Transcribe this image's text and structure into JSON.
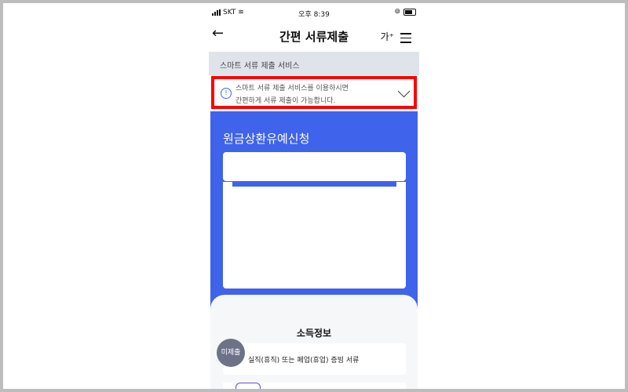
{
  "status_bar": {
    "carrier": "SKT",
    "time": "오후 8:39"
  },
  "header": {
    "title": "간편 서류제출",
    "font_size_label": "가⁺"
  },
  "section": {
    "label": "스마트 서류 제출 서비스"
  },
  "notice": {
    "line1": "스마트 서류 제출 서비스를 이용하시면",
    "line2": "간편하게 서류 제출이 가능합니다."
  },
  "application": {
    "title": "원금상환유예신청"
  },
  "income": {
    "title": "소득정보",
    "doc_label": "실직(휴직) 또는 폐업(휴업) 증빙 서류",
    "badge": "미제출"
  },
  "colors": {
    "primary": "#3f63ea",
    "highlight": "#ff0000"
  }
}
